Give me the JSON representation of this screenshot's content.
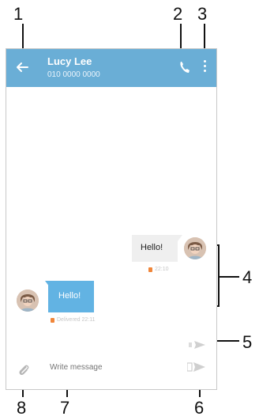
{
  "callouts": [
    "1",
    "2",
    "3",
    "4",
    "5",
    "6",
    "7",
    "8"
  ],
  "header": {
    "contact_name": "Lucy Lee",
    "phone_number": "010 0000 0000"
  },
  "messages": [
    {
      "direction": "outgoing",
      "text": "Hello!",
      "meta": "22:10"
    },
    {
      "direction": "incoming",
      "text": "Hello!",
      "meta": "Delivered 22:11"
    }
  ],
  "composer": {
    "placeholder": "Write message"
  },
  "icons": [
    "back-arrow-icon",
    "phone-icon",
    "more-vert-icon",
    "avatar",
    "send-icon",
    "paperclip-icon"
  ],
  "colors": {
    "appbar": "#6aaed6",
    "incoming_bubble": "#62b3e3",
    "outgoing_bubble": "#efefef",
    "status_dot": "#f0863a"
  }
}
